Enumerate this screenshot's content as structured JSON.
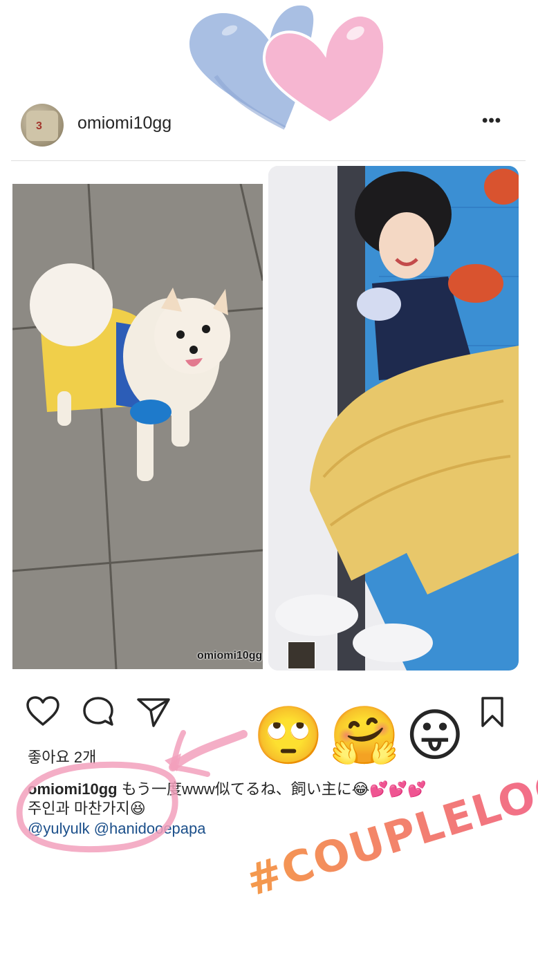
{
  "post": {
    "username": "omiomi10gg",
    "more_label": "•••",
    "watermark": "omiomi10gg",
    "likes": "좋아요 2개",
    "caption": {
      "user": "omiomi10gg",
      "line1": "もう一度www似てるね、飼い主に😂💕💕💕",
      "line2": "주인과 마찬가지😆",
      "mentions": "@yulyulk @hanidooepapa"
    }
  },
  "stickers": {
    "emojis": [
      "🙄",
      "🤗",
      "😛"
    ],
    "hashtag": "#COUPLELOOK"
  },
  "colors": {
    "heart_blue": "#a9bfe3",
    "heart_pink": "#f6b6d1",
    "annotation_pink": "#f2a0bc",
    "hashtag_start": "#f49a4b",
    "hashtag_end": "#f1639a"
  },
  "icons": {
    "like": "heart-outline-icon",
    "comment": "comment-bubble-icon",
    "share": "paper-plane-icon",
    "save": "bookmark-icon",
    "more": "ellipsis-icon"
  }
}
